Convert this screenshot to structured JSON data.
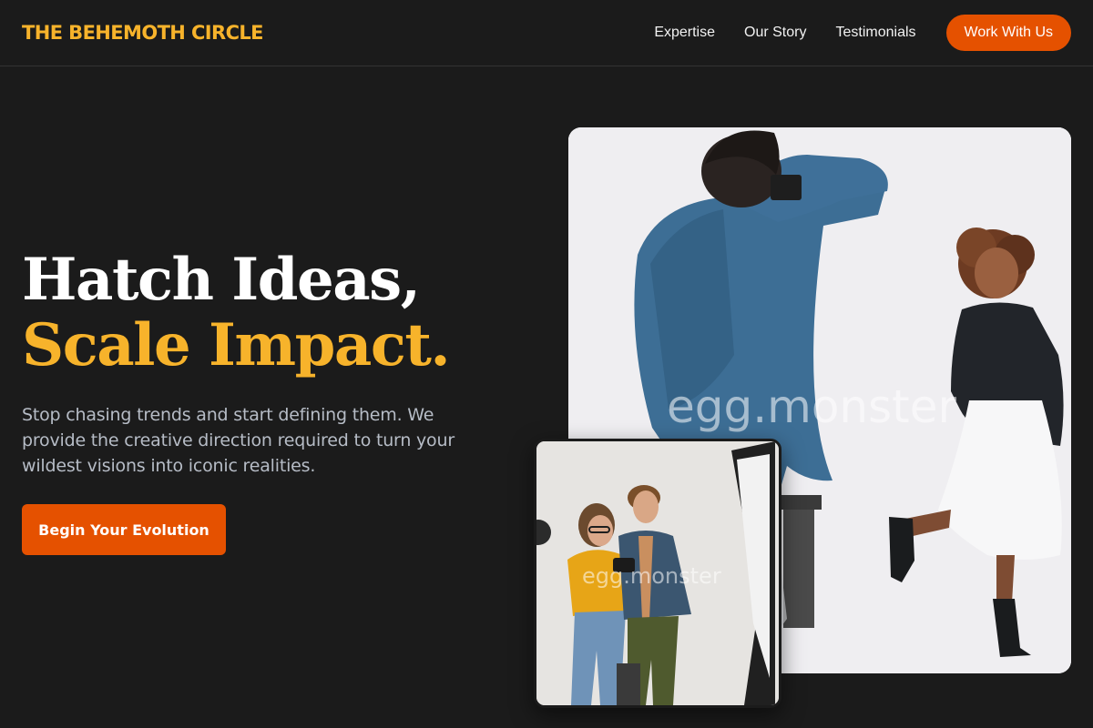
{
  "brand": {
    "name": "THE BEHEMOTH CIRCLE"
  },
  "nav": {
    "links": [
      "Expertise",
      "Our Story",
      "Testimonials"
    ],
    "cta_label": "Work With Us"
  },
  "hero": {
    "headline_line1": "Hatch Ideas,",
    "headline_line2": "Scale Impact.",
    "lead": "Stop chasing trends and start defining them. We provide the creative direction required to turn your wildest visions into iconic realities.",
    "button_label": "Begin Your Evolution"
  },
  "images": {
    "main_watermark": "egg.monster",
    "small_watermark": "egg.monster"
  },
  "colors": {
    "background": "#1b1b1b",
    "accent_orange": "#e55100",
    "accent_gold": "#f7b32b"
  }
}
